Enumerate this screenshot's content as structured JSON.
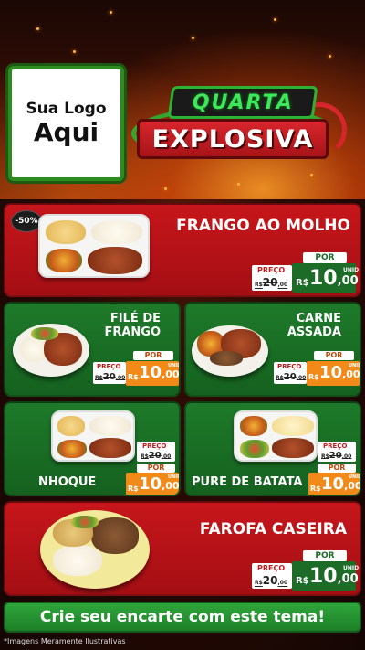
{
  "header": {
    "logo_line1": "Sua Logo",
    "logo_line2": "Aqui",
    "badge_top": "QUARTA",
    "badge_bottom": "EXPLOSIVA"
  },
  "colors": {
    "red": "#c6161b",
    "green": "#1e7a2a",
    "orange": "#f28a1a",
    "dark_green": "#1c6b27"
  },
  "price_labels": {
    "preco": "PREÇO",
    "por": "POR",
    "currency": "R$",
    "unid": "UNID"
  },
  "products": [
    {
      "name": "FRANGO AO MOLHO",
      "discount": "-50%",
      "old_int": "20",
      "old_dec": ",00",
      "new_int": "10",
      "new_dec": ",00"
    },
    {
      "name_l1": "FILÉ DE",
      "name_l2": "FRANGO",
      "old_int": "20",
      "old_dec": ",00",
      "new_int": "10",
      "new_dec": ",00"
    },
    {
      "name_l1": "CARNE",
      "name_l2": "ASSADA",
      "old_int": "20",
      "old_dec": ",00",
      "new_int": "10",
      "new_dec": ",00"
    },
    {
      "name": "NHOQUE",
      "old_int": "20",
      "old_dec": ",00",
      "new_int": "10",
      "new_dec": ",00"
    },
    {
      "name": "PURE DE BATATA",
      "old_int": "20",
      "old_dec": ",00",
      "new_int": "10",
      "new_dec": ",00"
    },
    {
      "name": "FAROFA CASEIRA",
      "old_int": "20",
      "old_dec": ",00",
      "new_int": "10",
      "new_dec": ",00"
    }
  ],
  "cta": "Crie seu encarte com este tema!",
  "footnote": "*Imagens Meramente Ilustrativas"
}
